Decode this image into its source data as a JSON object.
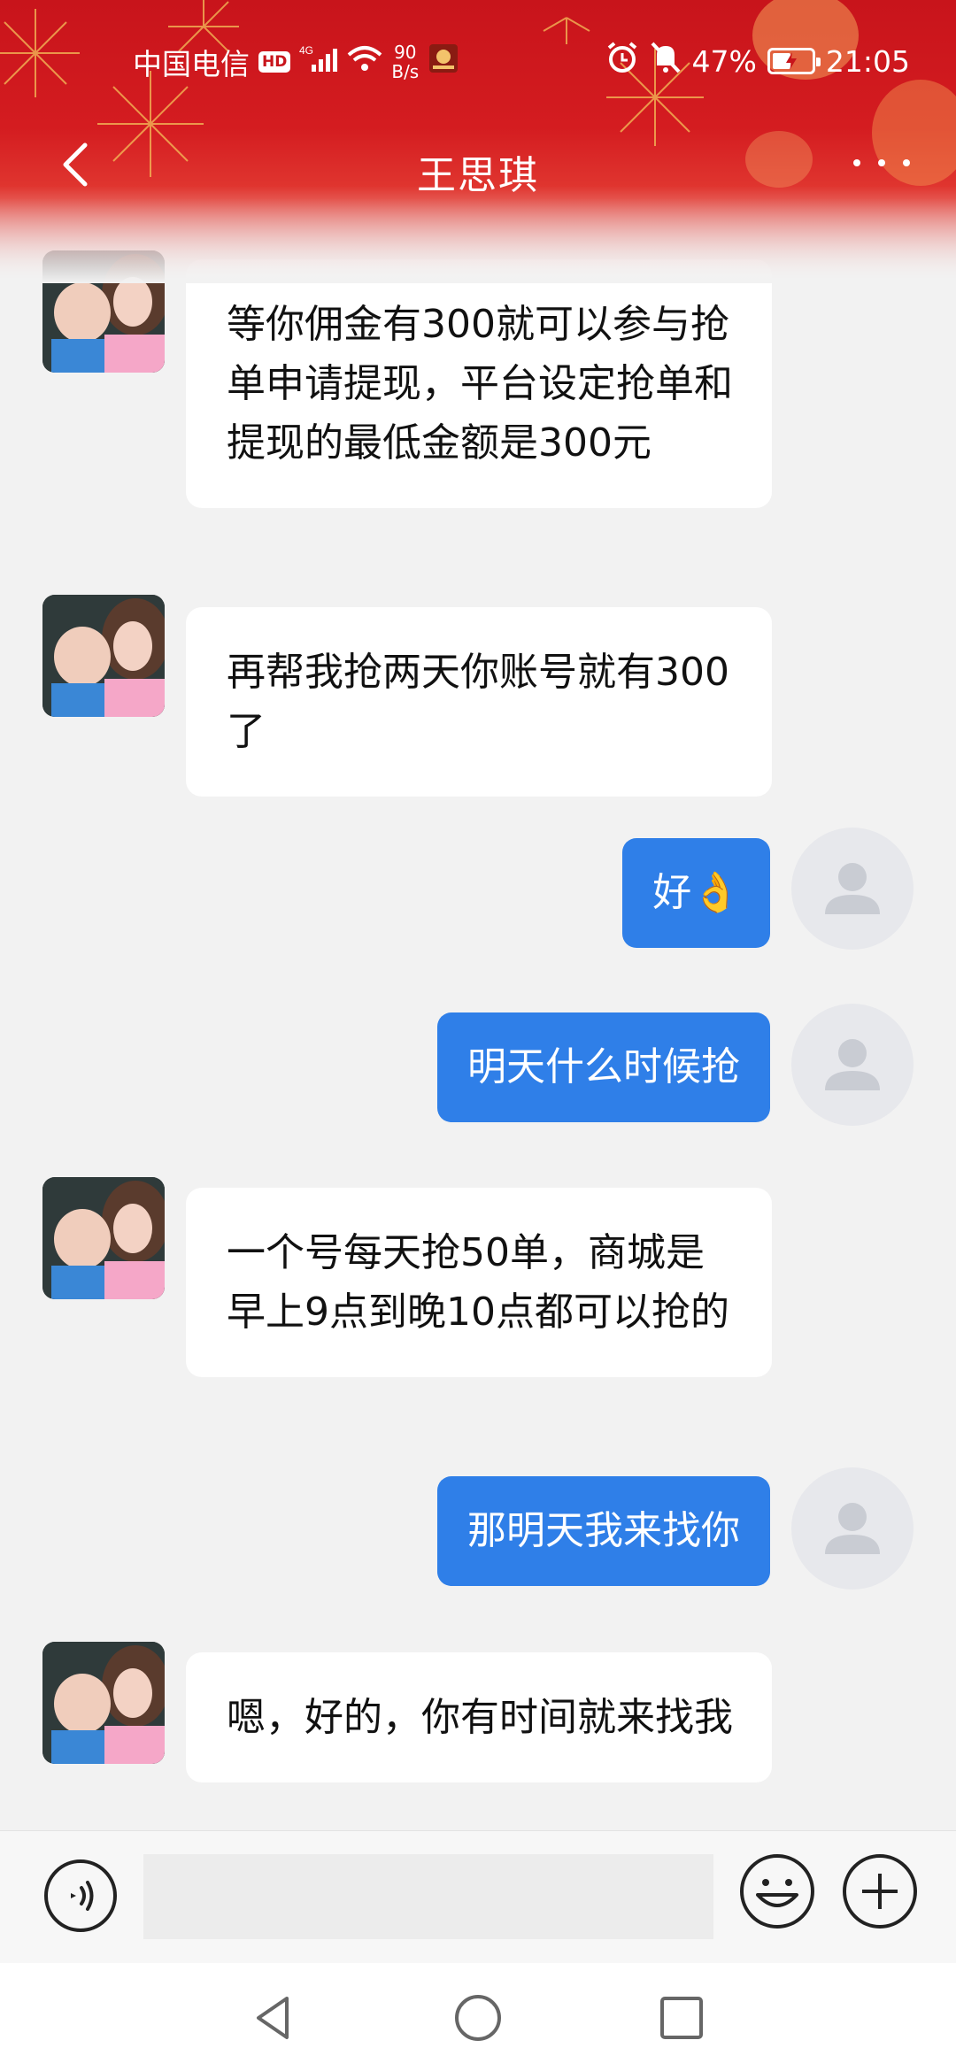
{
  "status_bar": {
    "carrier": "中国电信",
    "hd": "HD",
    "network": "4G",
    "net_speed_value": "90",
    "net_speed_unit": "B/s",
    "battery": "47%",
    "battery_level": 0.47,
    "time": "21:05"
  },
  "header": {
    "title": "王思琪",
    "accent_color": "#c8141b"
  },
  "messages": [
    {
      "side": "in",
      "text": "等你佣金有300就可以参与抢单申请提现，平台设定抢单和提现的最低金额是300元"
    },
    {
      "side": "in",
      "text": "再帮我抢两天你账号就有300了"
    },
    {
      "side": "out",
      "text": "好👌"
    },
    {
      "side": "out",
      "text": "明天什么时候抢"
    },
    {
      "side": "in",
      "text": "一个号每天抢50单，商城是早上9点到晚10点都可以抢的"
    },
    {
      "side": "out",
      "text": "那明天我来找你"
    },
    {
      "side": "in",
      "text": "嗯，好的，你有时间就来找我"
    }
  ],
  "input": {
    "value": "",
    "placeholder": ""
  },
  "colors": {
    "outgoing_bubble": "#2f7fe8",
    "incoming_bubble": "#ffffff",
    "background": "#f2f2f2"
  },
  "icons": {
    "back": "chevron-left-icon",
    "more": "more-dots-icon",
    "voice": "voice-icon",
    "emoji": "emoji-icon",
    "plus": "plus-icon",
    "nav_back": "triangle-back-icon",
    "nav_home": "circle-home-icon",
    "nav_recent": "square-recent-icon"
  }
}
